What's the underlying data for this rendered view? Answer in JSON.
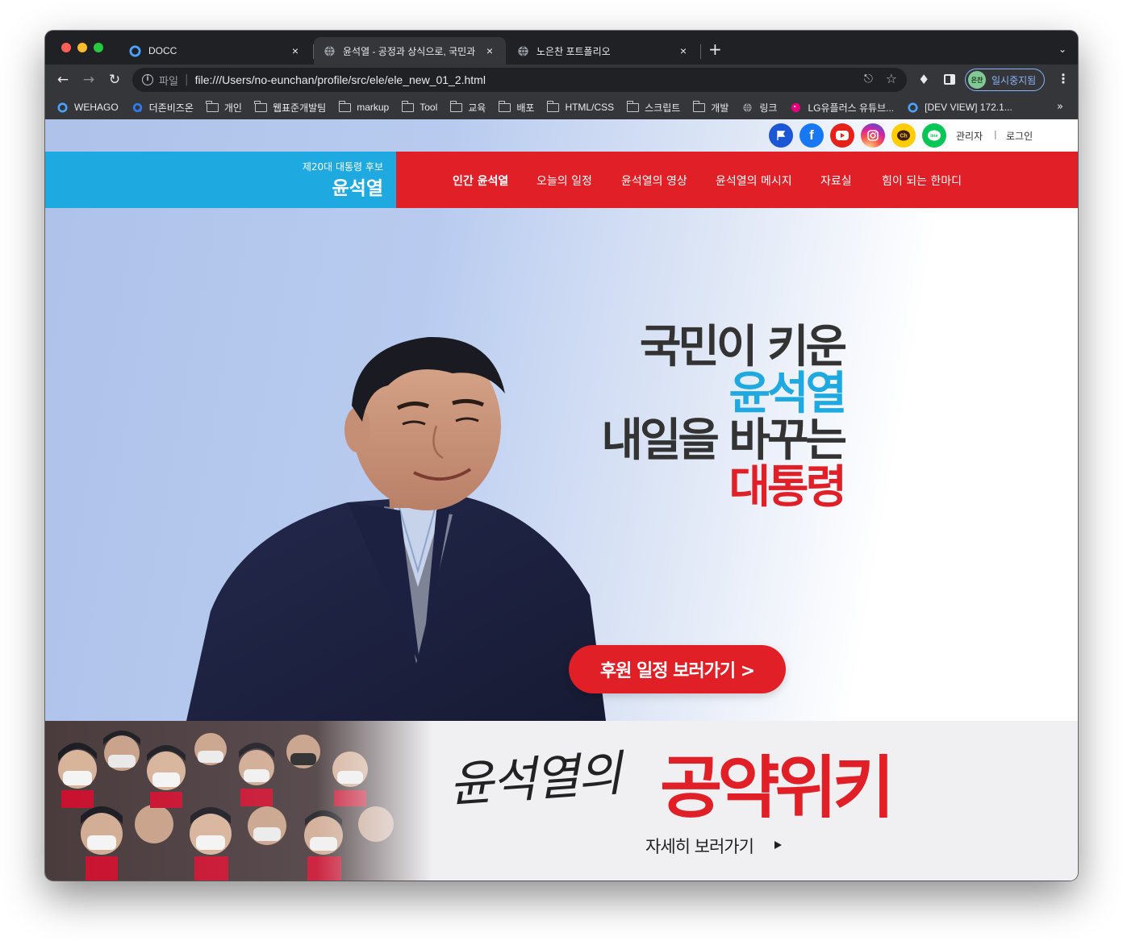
{
  "browser": {
    "tabs": [
      {
        "title": "DOCC",
        "favicon": "docc-icon",
        "active": false
      },
      {
        "title": "윤석열 - 공정과 상식으로, 국민과 함",
        "favicon": "globe-icon",
        "active": true
      },
      {
        "title": "노은찬 포트폴리오",
        "favicon": "globe-icon",
        "active": false
      }
    ],
    "new_tab": "+",
    "close_glyph": "×",
    "address": {
      "prefix": "파일",
      "url": "file:///Users/no-eunchan/profile/src/ele/ele_new_01_2.html"
    },
    "profile": {
      "avatar": "은찬",
      "label": "일시중지됨"
    },
    "bookmarks": [
      {
        "label": "WEHAGO",
        "icon": "wehago-icon"
      },
      {
        "label": "더존비즈온",
        "icon": "douzone-icon"
      },
      {
        "label": "개인",
        "icon": "folder-icon"
      },
      {
        "label": "웹표준개발팀",
        "icon": "folder-icon"
      },
      {
        "label": "markup",
        "icon": "folder-icon"
      },
      {
        "label": "Tool",
        "icon": "folder-icon"
      },
      {
        "label": "교육",
        "icon": "folder-icon"
      },
      {
        "label": "배포",
        "icon": "folder-icon"
      },
      {
        "label": "HTML/CSS",
        "icon": "folder-icon"
      },
      {
        "label": "스크립트",
        "icon": "folder-icon"
      },
      {
        "label": "개발",
        "icon": "folder-icon"
      },
      {
        "label": "링크",
        "icon": "globe-icon"
      },
      {
        "label": "LG유플러스 유튜브...",
        "icon": "lguplus-icon"
      },
      {
        "label": "[DEV VIEW] 172.1...",
        "icon": "devview-icon"
      }
    ],
    "bookmarks_more": "»"
  },
  "site": {
    "top_links": {
      "admin": "관리자",
      "divider": "|",
      "login": "로그인"
    },
    "social_icons": [
      "flag-icon",
      "facebook-icon",
      "youtube-icon",
      "instagram-icon",
      "kakao-channel-icon",
      "line-icon"
    ],
    "social_glyphs": {
      "facebook": "f",
      "channel": "Ch",
      "line": "line"
    },
    "header": {
      "subtitle": "제20대 대통령 후보",
      "name": "윤석열"
    },
    "gnb": [
      {
        "label": "인간 윤석열",
        "active": true
      },
      {
        "label": "오늘의 일정",
        "active": false
      },
      {
        "label": "윤석열의 영상",
        "active": false
      },
      {
        "label": "윤석열의 메시지",
        "active": false
      },
      {
        "label": "자료실",
        "active": false
      },
      {
        "label": "힘이 되는 한마디",
        "active": false
      }
    ],
    "hero": {
      "line1": "국민이 키운",
      "line2": "윤석열",
      "line3": "내일을 바꾸는",
      "line4": "대통령",
      "button": "후원 일정 보러가기 >"
    },
    "banner": {
      "script": "윤석열의",
      "title": "공약위키",
      "more": "자세히 보러가기"
    },
    "colors": {
      "blue": "#1fa9e1",
      "red": "#e01f26",
      "dark": "#333333"
    }
  }
}
